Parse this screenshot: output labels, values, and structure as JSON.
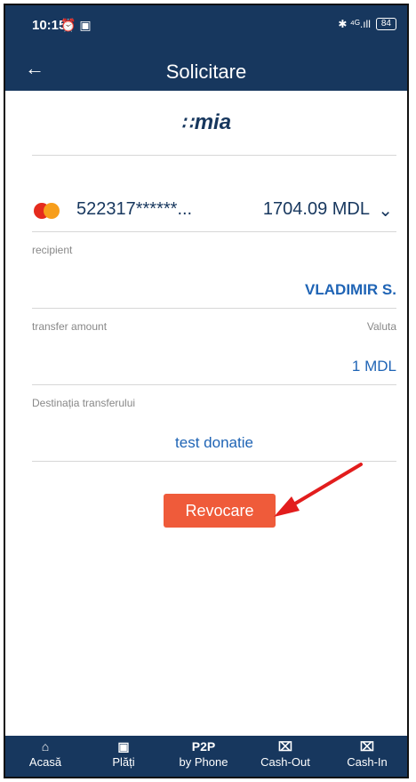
{
  "status": {
    "time": "10:15",
    "icons": "⏰ ▣",
    "network": "✱ ⁴ᴳ.ıll",
    "battery": "84"
  },
  "appbar": {
    "back": "←",
    "title": "Solicitare"
  },
  "brand": {
    "logo_mark": "∷",
    "logo": "mia"
  },
  "card": {
    "number": "522317******...",
    "balance": "1704.09 MDL",
    "chevron": "⌄"
  },
  "recipient": {
    "label": "recipient",
    "value": "VLADIMIR S."
  },
  "amount": {
    "label": "transfer amount",
    "currency_label": "Valuta",
    "value": "1 MDL"
  },
  "destination": {
    "label": "Destinația transferului",
    "value": "test donatie"
  },
  "action": {
    "button": "Revocare"
  },
  "nav": {
    "items": [
      {
        "icon": "⌂",
        "label": "Acasă"
      },
      {
        "icon": "▣",
        "label": "Plăți"
      },
      {
        "icon": "P2P",
        "label": "by Phone"
      },
      {
        "icon": "⌧",
        "label": "Cash-Out"
      },
      {
        "icon": "⌧",
        "label": "Cash-In"
      }
    ]
  },
  "colors": {
    "primary": "#17375e",
    "accent": "#ef5b3a",
    "link": "#1f64b5"
  }
}
